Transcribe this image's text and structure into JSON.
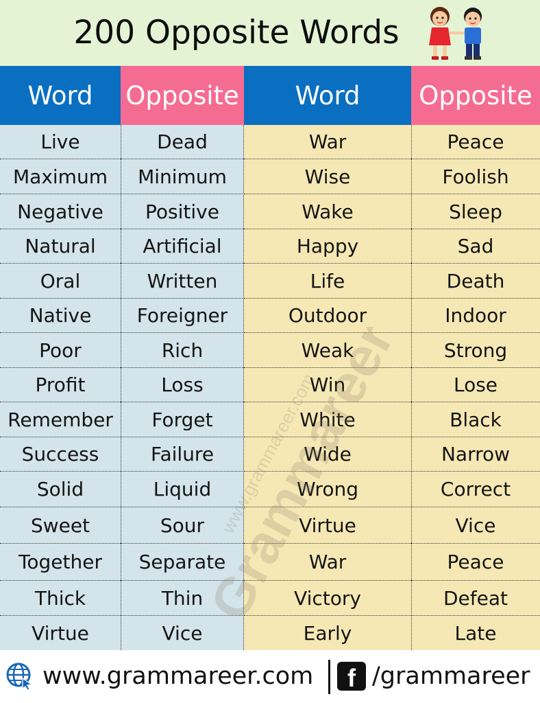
{
  "title": "200 Opposite Words",
  "headers": [
    "Word",
    "Opposite",
    "Word",
    "Opposite"
  ],
  "colors": {
    "blue_header": "#0a6fc1",
    "pink_header": "#f56c93",
    "left_body": "#d3e4eb",
    "right_body": "#f6e8b5",
    "top_band": "#e4f3d4"
  },
  "left_pairs": [
    [
      "Live",
      "Dead"
    ],
    [
      "Maximum",
      "Minimum"
    ],
    [
      "Negative",
      "Positive"
    ],
    [
      "Natural",
      "Artificial"
    ],
    [
      "Oral",
      "Written"
    ],
    [
      "Native",
      "Foreigner"
    ],
    [
      "Poor",
      "Rich"
    ],
    [
      "Profit",
      "Loss"
    ],
    [
      "Remember",
      "Forget"
    ],
    [
      "Success",
      "Failure"
    ],
    [
      "Solid",
      "Liquid"
    ],
    [
      "Sweet",
      "Sour"
    ],
    [
      "Together",
      "Separate"
    ],
    [
      "Thick",
      "Thin"
    ],
    [
      "Virtue",
      "Vice"
    ]
  ],
  "right_pairs": [
    [
      "War",
      "Peace"
    ],
    [
      "Wise",
      "Foolish"
    ],
    [
      "Wake",
      "Sleep"
    ],
    [
      "Happy",
      "Sad"
    ],
    [
      "Life",
      "Death"
    ],
    [
      "Outdoor",
      "Indoor"
    ],
    [
      "Weak",
      "Strong"
    ],
    [
      "Win",
      "Lose"
    ],
    [
      "White",
      "Black"
    ],
    [
      "Wide",
      "Narrow"
    ],
    [
      "Wrong",
      "Correct"
    ],
    [
      "Virtue",
      "Vice"
    ],
    [
      "War",
      "Peace"
    ],
    [
      "Victory",
      "Defeat"
    ],
    [
      "Early",
      "Late"
    ]
  ],
  "watermark": {
    "site": "www.grammareer.com",
    "brand": "Grammareer"
  },
  "footer": {
    "website": "www.grammareer.com",
    "facebook_icon_letter": "f",
    "handle": "/grammareer",
    "icons": [
      "globe-cursor-icon",
      "facebook-icon"
    ]
  }
}
